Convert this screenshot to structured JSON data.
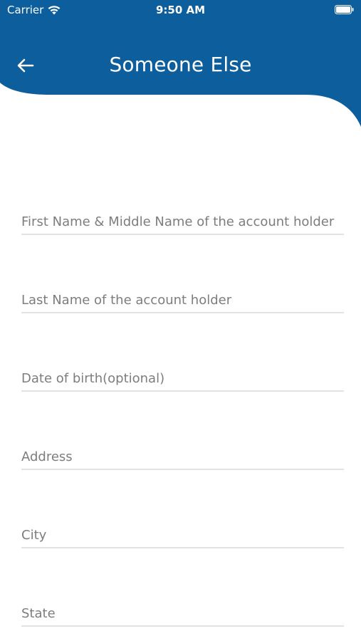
{
  "status_bar": {
    "carrier": "Carrier",
    "time": "9:50 AM",
    "icons": [
      "wifi-icon",
      "battery-icon"
    ]
  },
  "header": {
    "title": "Someone Else",
    "back_icon": "arrow-left-icon",
    "color": "#0d5e9c"
  },
  "form": {
    "fields": [
      {
        "placeholder": "First Name & Middle Name of the account holder"
      },
      {
        "placeholder": "Last Name of the account holder"
      },
      {
        "placeholder": "Date of birth(optional)"
      },
      {
        "placeholder": "Address"
      },
      {
        "placeholder": "City"
      },
      {
        "placeholder": "State"
      }
    ]
  }
}
